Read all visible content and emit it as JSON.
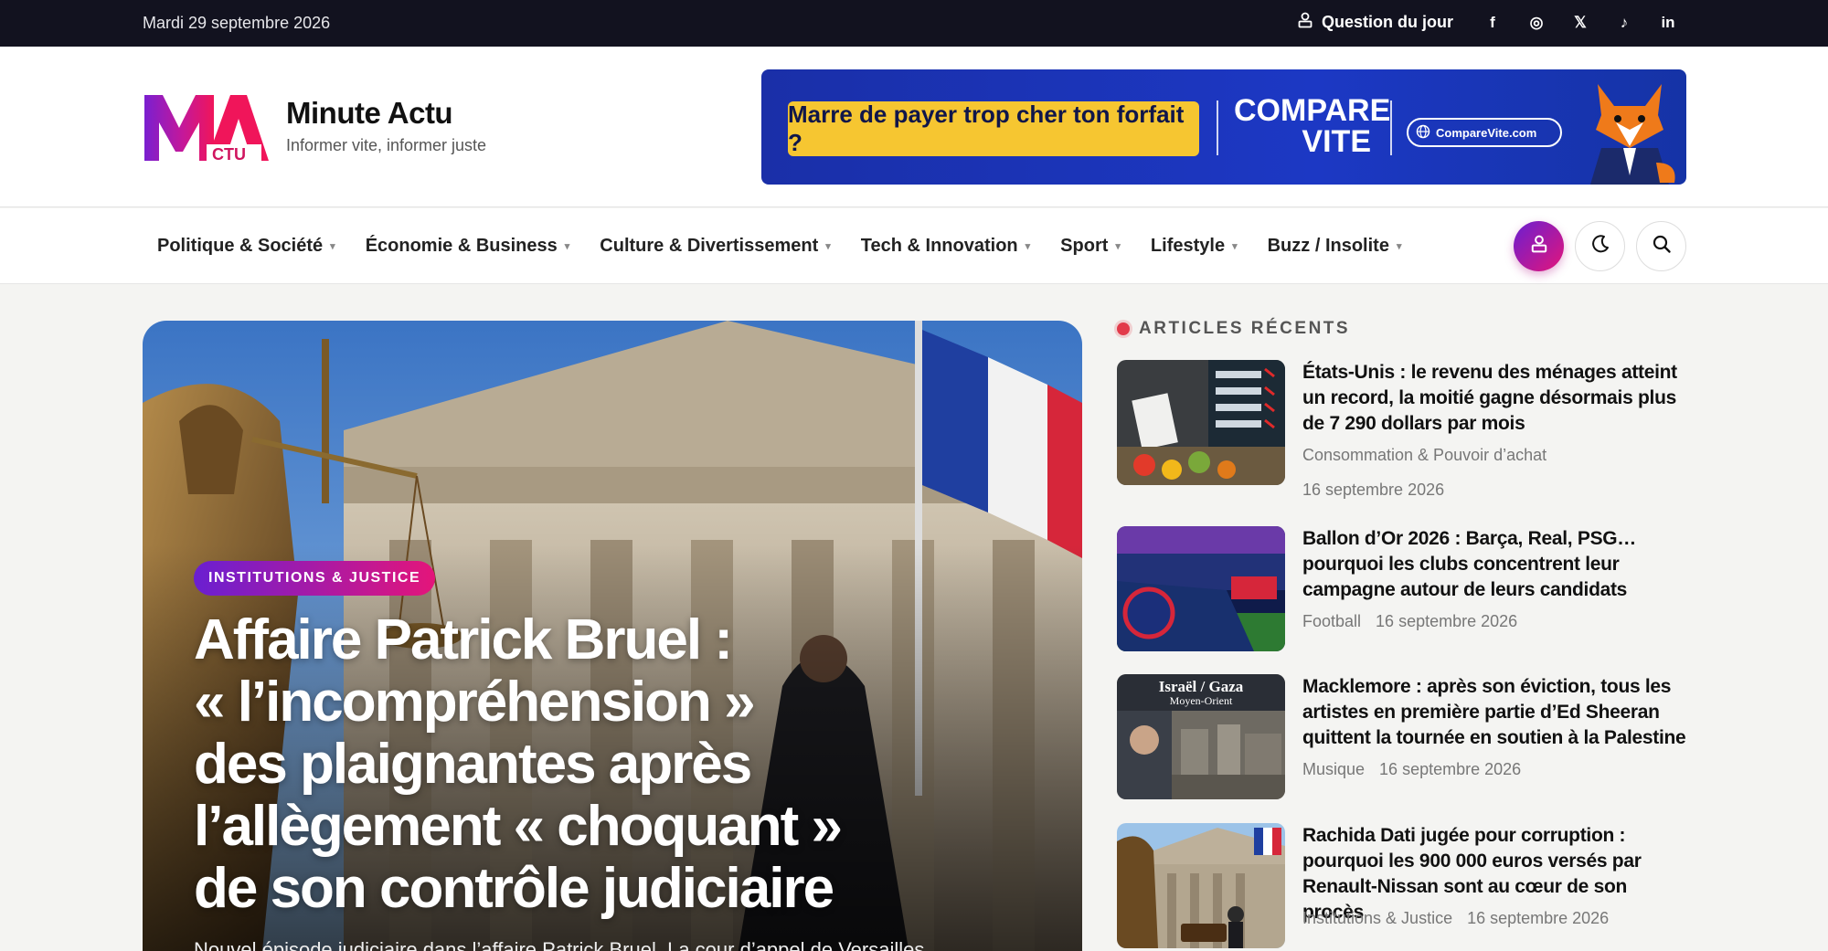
{
  "topbar": {
    "date": "Mardi 29 septembre 2026",
    "question_label": "Question du jour",
    "social": [
      "f",
      "◎",
      "𝕏",
      "♪",
      "in"
    ]
  },
  "header": {
    "site_name": "Minute Actu",
    "tagline": "Informer vite, informer juste",
    "logo_text": "MA",
    "logo_sub": "CTU"
  },
  "ad": {
    "headline": "Marre de payer trop cher ton forfait ?",
    "brand_line1": "COMPARE",
    "brand_line2": "VITE",
    "url": "CompareVite.com"
  },
  "nav": {
    "items": [
      "Politique & Société",
      "Économie & Business",
      "Culture & Divertissement",
      "Tech & Innovation",
      "Sport",
      "Lifestyle",
      "Buzz / Insolite"
    ]
  },
  "hero": {
    "category": "INSTITUTIONS & JUSTICE",
    "title_lines": [
      "Affaire Patrick Bruel :",
      "« l’incompréhension »",
      "des plaignantes après",
      "l’allègement « choquant »",
      "de son contrôle judiciaire"
    ],
    "excerpt": "Nouvel épisode judiciaire dans l’affaire Patrick Bruel. La cour d’appel de Versailles"
  },
  "sidebar": {
    "heading": "ARTICLES RÉCENTS",
    "articles": [
      {
        "title": "États-Unis : le revenu des ménages atteint un record, la moitié gagne désormais plus de 7 290 dollars par mois",
        "category": "Consommation & Pouvoir d’achat",
        "date": "16 septembre 2026"
      },
      {
        "title": "Ballon d’Or 2026 : Barça, Real, PSG… pourquoi les clubs concentrent leur campagne autour de leurs candidats",
        "category": "Football",
        "date": "16 septembre 2026"
      },
      {
        "title": "Macklemore : après son éviction, tous les artistes en première partie d’Ed Sheeran quittent la tournée en soutien à la Palestine",
        "category": "Musique",
        "date": "16 septembre 2026",
        "thumb_caption_1": "Israël / Gaza",
        "thumb_caption_2": "Moyen-Orient"
      },
      {
        "title": "Rachida Dati jugée pour corruption : pourquoi les 900 000 euros versés par Renault-Nissan sont au cœur de son procès",
        "category": "Institutions & Justice",
        "date": "16 septembre 2026"
      }
    ]
  }
}
